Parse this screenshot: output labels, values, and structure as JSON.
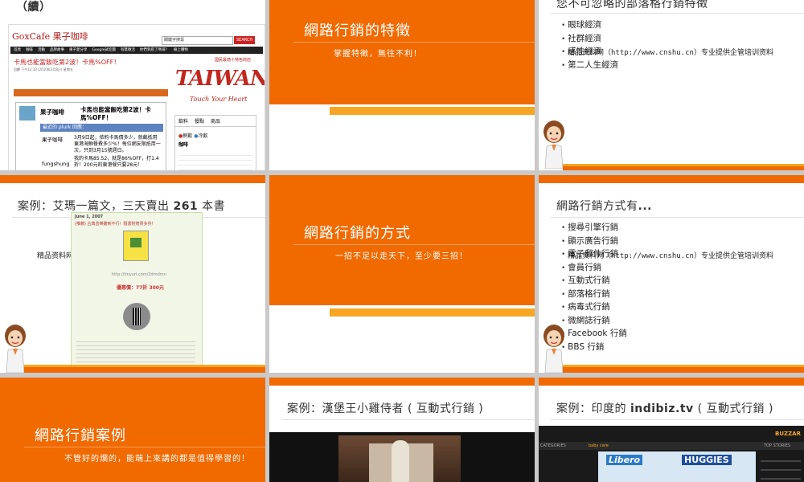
{
  "slides": {
    "s1": {
      "title": "（續）",
      "site_logo": "GoxCafe 果子咖啡",
      "search_placeholder": "關鍵字搜尋",
      "search_button": "SEARCH",
      "nav": [
        "首頁",
        "咖啡",
        "活動",
        "品牌故事",
        "果子愛分享",
        "Google試吃團",
        "有獎徵活",
        "你們到底了嗎啡？",
        "線上購物"
      ],
      "headline": "卡馬也能當飯吃第2波！卡馬%OFF！",
      "meta": "回覆 下午12:33 (2010年3月8日) 星期五",
      "ad_title": "國民最適十特色商店",
      "ad_brand": "TAIWAN",
      "ad_slogan": "Touch Your Heart",
      "widget_tabs": [
        "飲料",
        "餐點",
        "商品"
      ],
      "widget_labels": [
        "熱飲",
        "冷飲"
      ],
      "widget_heading": "咖啡",
      "plurk_user": "果子咖啡",
      "plurk_text": "卡馬也能當飯吃第2波！卡馬%OFF！",
      "plurk_bar": "最近的 plurk 回應：",
      "reply1_user": "果子咖啡",
      "reply1_text": "3月9日起，依約卡馬價多少，就截抵用東港海鮮餐費多少%！每位網友限抵用一次，只到3月15號週日。",
      "reply2_user": "fungshung",
      "reply2_text": "我的卡馬85.52，就是86%OFF，打1.4折！200元的東港餐只要28元！"
    },
    "s2": {
      "title": "網路行銷的特徵",
      "subtitle": "掌握特徵，無往不利！"
    },
    "s3": {
      "title": "您不可忽略的部落格行銷特徵",
      "bullets": [
        "眼球經濟",
        "社群經濟",
        "感性經濟",
        "第二人生經濟"
      ],
      "watermark": "精品资料网（http://www.cnshu.cn）专业提供企管培训资料"
    },
    "s4": {
      "title_prefix": "案例：艾瑪一篇文，三天賣出 ",
      "title_bold": "261",
      "title_suffix": " 本書",
      "watermark": "精品资料网（ht",
      "blog_date": "June 1, 2007",
      "blog_heading": "(推薦) 古典音樂聽到不行！隨書附贈貝多芬！",
      "blog_link": "http://tinyurl.com/2dmdmn",
      "blog_price": "優惠價：77折 300元"
    },
    "s5": {
      "title": "網路行銷的方式",
      "subtitle": "一招不足以走天下，至少要三招！"
    },
    "s6": {
      "title_prefix": "網路行銷方式有",
      "title_bold": "...",
      "bullets": [
        "搜尋引擎行銷",
        "顯示廣告行銷",
        "電子郵件行銷",
        "會員行銷",
        "互動式行銷",
        "部落格行銷",
        "病毒式行銷",
        "微網誌行銷",
        "Facebook 行銷",
        "BBS 行銷"
      ],
      "watermark": "精品资料网（http://www.cnshu.cn）专业提供企管培训资料"
    },
    "s7": {
      "title": "網路行銷案例",
      "subtitle": "不管好的爛的，能端上來講的都是值得學習的！"
    },
    "s8": {
      "title": "案例：漢堡王小雞侍者 ( 互動式行銷 )"
    },
    "s9": {
      "title_prefix": "案例：印度的 ",
      "title_bold": "indibiz.tv",
      "title_suffix": " ( 互動式行銷 )",
      "nav_left": "CATEGORIES",
      "nav_mid": "baby care",
      "nav_right": "TOP STORIES",
      "brand1": "Libero",
      "brand2": "HUGGIES",
      "logo": "BUZZAR"
    }
  },
  "colors": {
    "accent": "#f06a00",
    "background": "#c9c9c9"
  }
}
